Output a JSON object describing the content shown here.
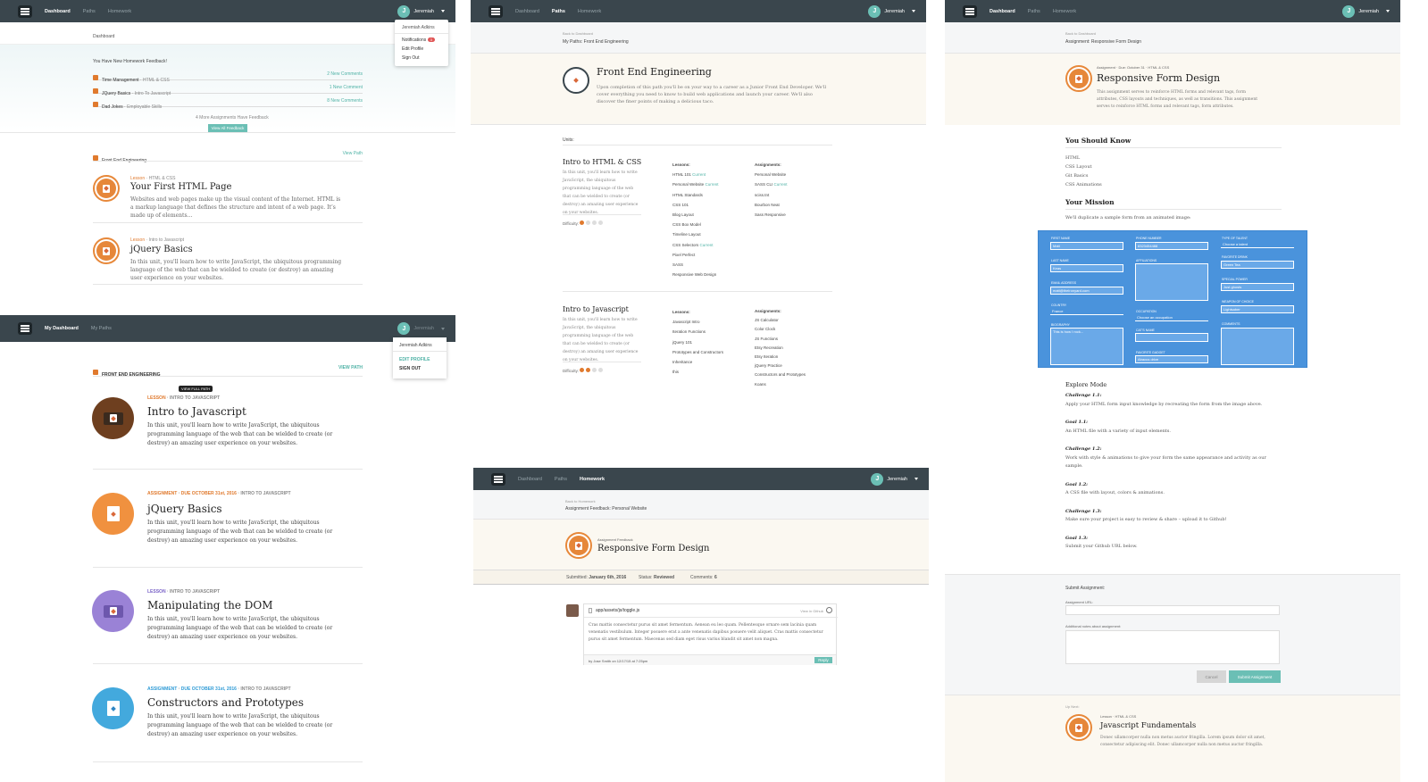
{
  "p1": {
    "nav": {
      "links": [
        "Dashboard",
        "Paths",
        "Homework"
      ],
      "user": "Jeremiah",
      "avatar": "J"
    },
    "menu": {
      "name": "Jeremiah Adkins",
      "notifications": "Notifications",
      "count": "3",
      "edit": "Edit Profile",
      "signout": "Sign Out"
    },
    "page_title": "Dashboard",
    "feedback": {
      "heading": "You Have New Homework Feedback!",
      "items": [
        {
          "title": "Time Management",
          "tag": "HTML & CSS",
          "count": "2 New Comments"
        },
        {
          "title": "JQuery Basics",
          "tag": "Intro To Javascript",
          "count": "1 New Comment"
        },
        {
          "title": "Dad Jokes",
          "tag": "Employable Skills",
          "count": "8 New Comments"
        }
      ],
      "more": "4 More Assignments Have Feedback",
      "button": "View All Feedback"
    },
    "path": {
      "name": "Front End Engineering",
      "link": "View Path"
    },
    "lessons": [
      {
        "type": "Lesson",
        "tag": "HTML & CSS",
        "title": "Your First HTML Page",
        "desc": "Websites and web pages make up the visual content of the Internet. HTML is a markup language that defines the structure and intent of a web page. It’s made up of elements…"
      },
      {
        "type": "Lesson",
        "tag": "Intro to Javascript",
        "title": "jQuery Basics",
        "desc": "In this unit, you'll learn how to write JavaScript, the ubiquitous programming language of the web that can be wielded to create (or destroy) an amazing user experience on your websites."
      }
    ]
  },
  "p2": {
    "nav": {
      "links": [
        "My Dashboard",
        "My Paths"
      ],
      "user": "Jeremiah",
      "avatar": "J"
    },
    "menu": {
      "name": "Jeremiah Adkins",
      "edit": "EDIT PROFILE",
      "signout": "SIGN OUT"
    },
    "path": {
      "name": "FRONT END ENGINEERING",
      "link": "VIEW PATH"
    },
    "tooltip": "VIEW FULL PATH",
    "items": [
      {
        "kind": "LESSON",
        "due": "",
        "tag": "INTRO TO JAVASCRIPT",
        "title": "Intro to Javascript",
        "desc": "In this unit, you'll learn how to write JavaScript, the ubiquitous programming language of the web that can be wielded to create (or destroy) an amazing user experience on your websites.",
        "color": "#6e3f1f"
      },
      {
        "kind": "ASSIGNMENT",
        "due": "DUE OCTOBER 31st, 2016",
        "tag": "INTRO TO JAVASCRIPT",
        "title": "jQuery Basics",
        "desc": "In this unit, you'll learn how to write JavaScript, the ubiquitous programming language of the web that can be wielded to create (or destroy) an amazing user experience on your websites.",
        "color": "#f0913f"
      },
      {
        "kind": "LESSON",
        "due": "",
        "tag": "INTRO TO JAVASCRIPT",
        "title": "Manipulating the DOM",
        "desc": "In this unit, you'll learn how to write JavaScript, the ubiquitous programming language of the web that can be wielded to create (or destroy) an amazing user experience on your websites.",
        "color": "#9a82d6"
      },
      {
        "kind": "ASSIGNMENT",
        "due": "DUE OCTOBER 31st, 2016",
        "tag": "INTRO TO JAVASCRIPT",
        "title": "Constructors and Prototypes",
        "desc": "In this unit, you'll learn how to write JavaScript, the ubiquitous programming language of the web that can be wielded to create (or destroy) an amazing user experience on your websites.",
        "color": "#43a9dd"
      }
    ]
  },
  "p3": {
    "nav": {
      "links": [
        "Dashboard",
        "Paths",
        "Homework"
      ],
      "user": "Jeremiah",
      "avatar": "J"
    },
    "back": "Back to Dashboard",
    "crumb": "My Paths: Front End Engineering",
    "title": "Front End Engineering",
    "desc": "Upon completion of this path you'll be on your way to a career as a Junior Front End Developer. We'll cover everything you need to know to build web applications and launch your career. We'll also discover the finer points of making a delicious taco.",
    "units_label": "Units:",
    "lessons_label": "Lessons:",
    "assignments_label": "Assignments:",
    "difficulty_label": "Difficulty:",
    "current": "Current",
    "units": [
      {
        "name": "Intro to HTML & CSS",
        "desc": "In this unit, you'll learn how to write JavaScript, the ubiquitous programming language of the web that can be wielded to create (or destroy) an amazing user experience on your websites.",
        "difficulty": 1,
        "lessons": [
          "HTML 101",
          "Personal Website",
          "HTML Standards",
          "CSS 101",
          "Blog Layout",
          "CSS Box Model",
          "Timeline Layout",
          "CSS Selectors",
          "Pixel Perfect",
          "SASS",
          "Responsive Web Design"
        ],
        "assignments": [
          "Personal Website",
          "SASS CLI",
          "sciss.tnt",
          "Bourbon Neat",
          "Sass Responsive"
        ]
      },
      {
        "name": "Intro to Javascript",
        "desc": "In this unit, you'll learn how to write JavaScript, the ubiquitous programming language of the web that can be wielded to create (or destroy) an amazing user experience on your websites.",
        "difficulty": 2,
        "lessons": [
          "Javascript Intro",
          "Iteration Functions",
          "jQuery 101",
          "Prototypes and Constructors",
          "Inheritance",
          "this"
        ],
        "assignments": [
          "JS Calculator",
          "Color Clock",
          "JS Functions",
          "Etsy Recreation",
          "Etsy Iteration",
          "jQuery Practice",
          "Constructors and Prototypes",
          "Koans"
        ]
      }
    ]
  },
  "p4": {
    "nav": {
      "links": [
        "Dashboard",
        "Paths",
        "Homework"
      ],
      "user": "Jeremiah",
      "avatar": "J"
    },
    "back": "Back to Homework",
    "crumb": "Assignment Feedback: Personal Website",
    "kicker": "Assignment Feedback",
    "title": "Responsive Form Design",
    "submitted_label": "Submitted:",
    "submitted": "January 6th, 2016",
    "status_label": "Status:",
    "status": "Reviewed",
    "comments_label": "Comments:",
    "comments": "6",
    "file": "app/assets/js/toggle.js",
    "view": "View in Github",
    "comment": "Cras mattis consectetur purus sit amet fermentum. Aenean eu leo quam. Pellentesque ornare sem lacinia quam venenatis vestibulum. Integer posuere erat a ante venenatis dapibus posuere velit aliquet. Cras mattis consectetur purus sit amet fermentum. Maecenas sed diam eget risus varius blandit sit amet non magna.",
    "byline": "by Jose Smith on 12/17/15 at 7:25pm",
    "reply": "Reply"
  },
  "p5": {
    "nav": {
      "links": [
        "Dashboard",
        "Paths",
        "Homework"
      ],
      "user": "Jeremiah",
      "avatar": "J"
    },
    "back": "Back to Dashboard",
    "crumb": "Assignment: Responsive Form Design",
    "meta": [
      "Assignment",
      "Due: October 31",
      "HTML & CSS"
    ],
    "title": "Responsive Form Design",
    "desc": "This assignment serves to reinforce HTML forms and relevant tags, form attributes, CSS layouts and techniques, as well as transitions. This assignment serves to reinforce HTML forms and relevant tags, form attributes.",
    "know_heading": "You Should Know",
    "know": [
      "HTML",
      "CSS Layout",
      "Git Basics",
      "CSS Animations"
    ],
    "mission_heading": "Your Mission",
    "mission_text": "We'll duplicate a sample form from an animated image:",
    "form": {
      "first_name": "FIRST NAME",
      "first_val": "Matt",
      "last_name": "LAST NAME",
      "last_val": "Keas",
      "email": "EMAIL ADDRESS",
      "email_val": "matt@theironyard.com",
      "country": "COUNTRY",
      "country_val": "France",
      "biography": "BIOGRAPHY",
      "bio_val": "This is how I rock...",
      "phone": "PHONE NUMBER",
      "phone_val": "8323454488",
      "affiliations": "AFFILIATIONS",
      "occupation": "OCCUPATION",
      "occ_val": "Choose an occupation",
      "cat": "CAT'S NAME",
      "gadget": "FAVORITE GADGET",
      "gadget_val": "Abacus drive",
      "talent": "TYPE OF TALENT",
      "talent_val": "Choose a talent",
      "drink": "FAVORITE DRINK",
      "drink_val": "Green Tea",
      "power": "SPECIAL POWER",
      "power_val": "Just ghosts",
      "weapon": "WEAPON OF CHOICE",
      "weapon_val": "Lightsaber",
      "comments": "COMMENTS"
    },
    "explore_heading": "Explore Mode",
    "challenges": [
      {
        "label": "Challenge 1.1:",
        "text": "Apply your HTML form input knowledge by recreating the form from the image above."
      },
      {
        "label": "Goal 1.1:",
        "text": "An HTML file with a variety of input elements."
      },
      {
        "label": "Challenge 1.2:",
        "text": "Work with style & animations to give your form the same appearance and activity as our sample."
      },
      {
        "label": "Goal 1.2:",
        "text": "A CSS file with layout, colors & animations."
      },
      {
        "label": "Challenge 1.3:",
        "text": "Make sure your project is easy to review & share – upload it to Github!"
      },
      {
        "label": "Goal 1.3:",
        "text": "Submit your Github URL below."
      }
    ],
    "submit_heading": "Submit Assignment:",
    "url_label": "Assignment URL:",
    "notes_label": "Additional notes about assignment:",
    "cancel": "Cancel",
    "submit": "Submit Assignment",
    "up_next": "Up Next:",
    "next_meta": [
      "Lesson",
      "HTML & CSS"
    ],
    "next_title": "Javascript Fundamentals",
    "next_desc": "Donec ullamcorper nulla non metus auctor fringilla. Lorem ipsum dolor sit amet, consectetur adipiscing elit. Donec ullamcorper nulla non metus auctor fringilla."
  },
  "colors": {
    "nav": "#3a464d",
    "teal": "#6bbfb5",
    "orange": "#e7883a",
    "form_blue": "#4a93dc",
    "cream": "#fbf8f1"
  }
}
